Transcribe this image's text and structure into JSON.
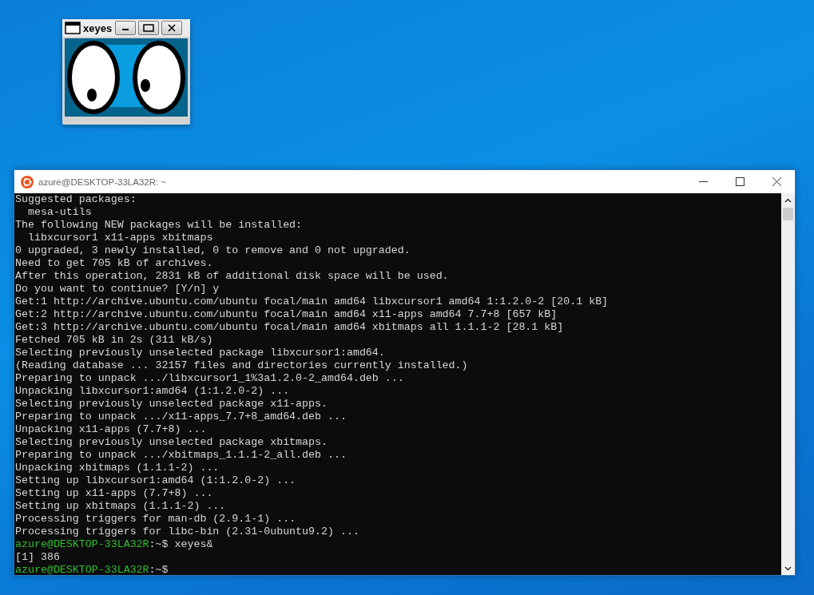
{
  "xeyes_window": {
    "title": "xeyes"
  },
  "terminal_window": {
    "title": "azure@DESKTOP-33LA32R: ~",
    "lines": [
      {
        "kind": "output",
        "text": "Suggested packages:"
      },
      {
        "kind": "output",
        "text": "  mesa-utils"
      },
      {
        "kind": "output",
        "text": "The following NEW packages will be installed:"
      },
      {
        "kind": "output",
        "text": "  libxcursor1 x11-apps xbitmaps"
      },
      {
        "kind": "output",
        "text": "0 upgraded, 3 newly installed, 0 to remove and 0 not upgraded."
      },
      {
        "kind": "output",
        "text": "Need to get 705 kB of archives."
      },
      {
        "kind": "output",
        "text": "After this operation, 2831 kB of additional disk space will be used."
      },
      {
        "kind": "output",
        "text": "Do you want to continue? [Y/n] y"
      },
      {
        "kind": "output",
        "text": "Get:1 http://archive.ubuntu.com/ubuntu focal/main amd64 libxcursor1 amd64 1:1.2.0-2 [20.1 kB]"
      },
      {
        "kind": "output",
        "text": "Get:2 http://archive.ubuntu.com/ubuntu focal/main amd64 x11-apps amd64 7.7+8 [657 kB]"
      },
      {
        "kind": "output",
        "text": "Get:3 http://archive.ubuntu.com/ubuntu focal/main amd64 xbitmaps all 1.1.1-2 [28.1 kB]"
      },
      {
        "kind": "output",
        "text": "Fetched 705 kB in 2s (311 kB/s)"
      },
      {
        "kind": "output",
        "text": "Selecting previously unselected package libxcursor1:amd64."
      },
      {
        "kind": "output",
        "text": "(Reading database ... 32157 files and directories currently installed.)"
      },
      {
        "kind": "output",
        "text": "Preparing to unpack .../libxcursor1_1%3a1.2.0-2_amd64.deb ..."
      },
      {
        "kind": "output",
        "text": "Unpacking libxcursor1:amd64 (1:1.2.0-2) ..."
      },
      {
        "kind": "output",
        "text": "Selecting previously unselected package x11-apps."
      },
      {
        "kind": "output",
        "text": "Preparing to unpack .../x11-apps_7.7+8_amd64.deb ..."
      },
      {
        "kind": "output",
        "text": "Unpacking x11-apps (7.7+8) ..."
      },
      {
        "kind": "output",
        "text": "Selecting previously unselected package xbitmaps."
      },
      {
        "kind": "output",
        "text": "Preparing to unpack .../xbitmaps_1.1.1-2_all.deb ..."
      },
      {
        "kind": "output",
        "text": "Unpacking xbitmaps (1.1.1-2) ..."
      },
      {
        "kind": "output",
        "text": "Setting up libxcursor1:amd64 (1:1.2.0-2) ..."
      },
      {
        "kind": "output",
        "text": "Setting up x11-apps (7.7+8) ..."
      },
      {
        "kind": "output",
        "text": "Setting up xbitmaps (1.1.1-2) ..."
      },
      {
        "kind": "output",
        "text": "Processing triggers for man-db (2.9.1-1) ..."
      },
      {
        "kind": "output",
        "text": "Processing triggers for libc-bin (2.31-0ubuntu9.2) ..."
      },
      {
        "kind": "prompt",
        "prompt": "azure@DESKTOP-33LA32R",
        "text": ":~$ xeyes&"
      },
      {
        "kind": "output",
        "text": "[1] 386"
      },
      {
        "kind": "prompt",
        "prompt": "azure@DESKTOP-33LA32R",
        "text": ":~$"
      }
    ]
  }
}
